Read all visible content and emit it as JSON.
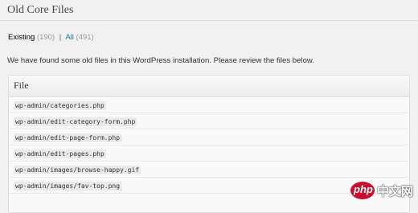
{
  "header": {
    "title": "Old Core Files"
  },
  "filters": {
    "existing_label": "Existing",
    "existing_count": "(190)",
    "separator": "|",
    "all_label": "All",
    "all_count": "(491)"
  },
  "notice": {
    "text": "We have found some old files in this WordPress installation. Please review the files below."
  },
  "table": {
    "column_header": "File",
    "rows": [
      "wp-admin/categories.php",
      "wp-admin/edit-category-form.php",
      "wp-admin/edit-page-form.php",
      "wp-admin/edit-pages.php",
      "wp-admin/images/browse-happy.gif",
      "wp-admin/images/fav-top.png"
    ]
  },
  "watermark": {
    "logo": "php",
    "brand": "中文网"
  },
  "colors": {
    "background": "#f1f1f1",
    "link": "#21759b",
    "watermark_red": "#c8102e"
  }
}
